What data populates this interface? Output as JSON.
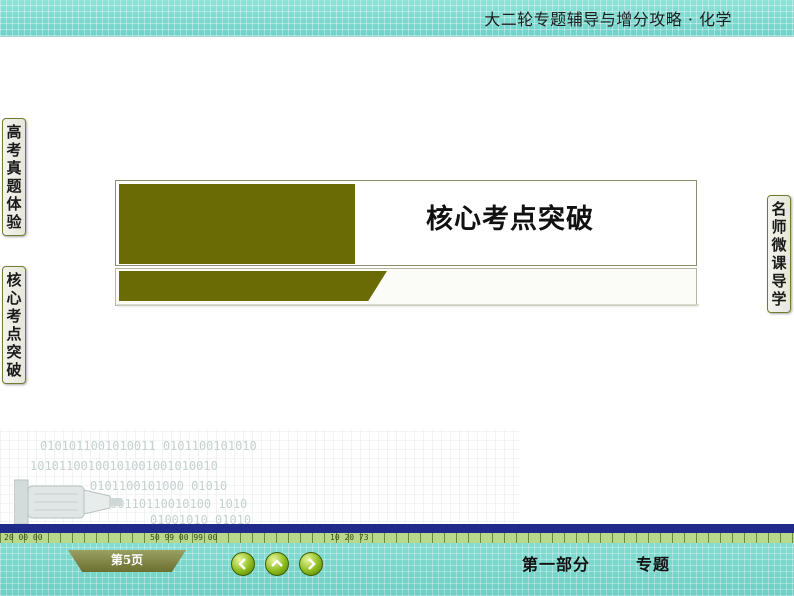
{
  "header": {
    "title": "大二轮专题辅导与增分攻略 · 化学"
  },
  "left_tabs": [
    {
      "label": "高考真题体验"
    },
    {
      "label": "核心考点突破"
    }
  ],
  "right_tabs": [
    {
      "label": "名师微课导学"
    }
  ],
  "main": {
    "title": "核心考点突破"
  },
  "footer": {
    "page_label": "第5页",
    "part_label": "第一部分",
    "topic_label": "专题"
  },
  "nav": {
    "icons": [
      "chevron-left-icon",
      "chevron-up-icon",
      "chevron-right-icon"
    ]
  },
  "colors": {
    "accent": "#6b6b06",
    "banner": "#7fdad0",
    "stripe": "#1f2a8a"
  }
}
